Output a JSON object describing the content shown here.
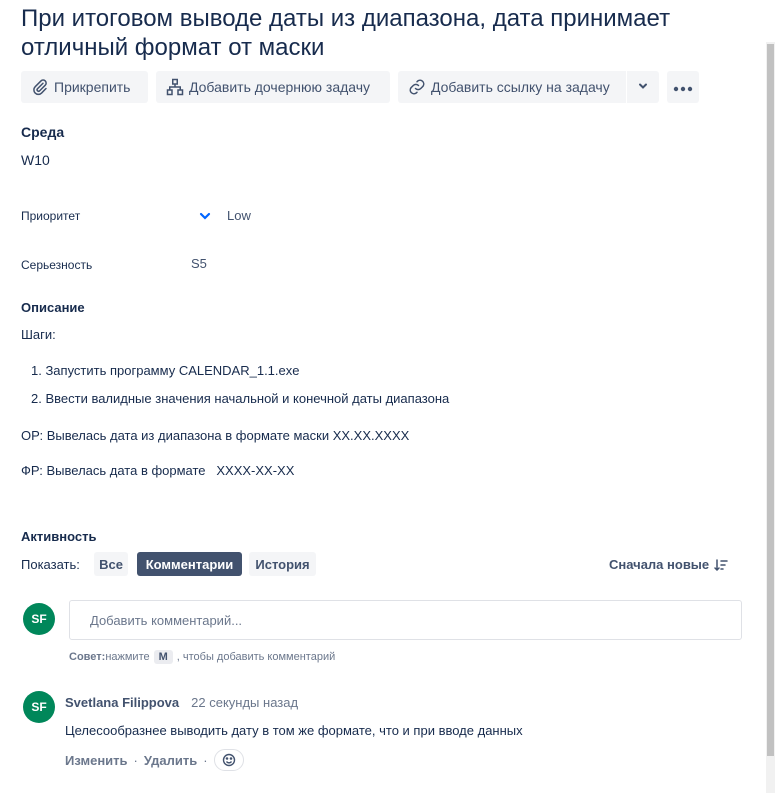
{
  "issue": {
    "title": "При итоговом выводе даты из диапазона, дата принимает отличный формат от маски"
  },
  "toolbar": {
    "attach": "Прикрепить",
    "add_child": "Добавить дочернюю задачу",
    "add_link": "Добавить ссылку на задачу"
  },
  "fields": {
    "environment_label": "Среда",
    "environment_value": "W10",
    "priority_label": "Приоритет",
    "priority_value": "Low",
    "severity_label": "Серьезность",
    "severity_value": "S5"
  },
  "description": {
    "label": "Описание",
    "steps_title": "Шаги:",
    "steps": [
      "1. Запустить программу CALENDAR_1.1.exe",
      "2. Ввести валидные значения начальной и конечной даты диапазона"
    ],
    "expected": "ОР: Вывелась дата из диапазона в формате маски XX.XX.XXXX",
    "actual": "ФР: Вывелась дата в формате   XXXX-XX-XX"
  },
  "activity": {
    "label": "Активность",
    "show_label": "Показать:",
    "filters": [
      "Все",
      "Комментарии",
      "История"
    ],
    "active_filter": "Комментарии",
    "sort": "Сначала новые"
  },
  "new_comment": {
    "avatar": "SF",
    "placeholder": "Добавить комментарий...",
    "hint_prefix": "Совет:",
    "hint_press": "нажмите",
    "hint_key": "M",
    "hint_suffix": ", чтобы добавить комментарий"
  },
  "comment": {
    "avatar": "SF",
    "author": "Svetlana Filippova",
    "time": "22 секунды назад",
    "text": "Целесообразнее выводить дату в том же формате, что и при вводе данных",
    "edit": "Изменить",
    "delete": "Удалить",
    "separator": "·"
  },
  "colors": {
    "text": "#172b4d",
    "muted": "#6b778c",
    "button_bg": "#f4f5f7",
    "active_filter_bg": "#42526e",
    "avatar_bg": "#00875a",
    "priority_icon": "#0065ff"
  },
  "icons": [
    "paperclip-icon",
    "hierarchy-icon",
    "link-icon",
    "chevron-down-icon",
    "more-icon",
    "priority-low-icon",
    "sort-icon",
    "reaction-icon"
  ]
}
